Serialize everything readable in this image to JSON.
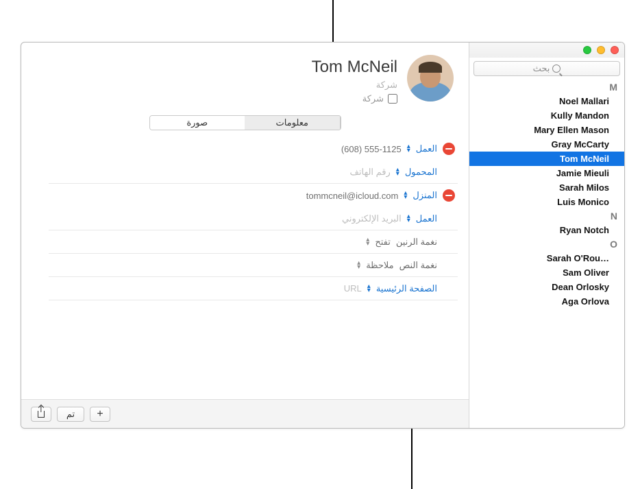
{
  "search": {
    "placeholder": "بحث"
  },
  "sections": [
    {
      "letter": "M",
      "items": [
        "Noel Mallari",
        "Kully Mandon",
        "Mary Ellen Mason",
        "Gray McCarty",
        "Tom McNeil",
        "Jamie Mieuli",
        "Sarah Milos",
        "Luis Monico"
      ]
    },
    {
      "letter": "N",
      "items": [
        "Ryan Notch"
      ]
    },
    {
      "letter": "O",
      "items": [
        "Sarah O'Rou…",
        "Sam Oliver",
        "Dean Orlosky",
        "Aga Orlova"
      ]
    }
  ],
  "selected_index": [
    0,
    4
  ],
  "contact": {
    "name": "Tom  McNeil",
    "company_placeholder": "شركة",
    "company_checkbox_label": "شركة"
  },
  "tabs": {
    "info": "معلومات",
    "photo": "صورة"
  },
  "fields": {
    "phone_work_label": "العمل",
    "phone_work_value": "(608) 555-1125",
    "phone_mobile_label": "المحمول",
    "phone_mobile_placeholder": "رقم الهاتف",
    "email_home_label": "المنزل",
    "email_home_value": "tommcneil@icloud.com",
    "email_work_label": "العمل",
    "email_work_placeholder": "البريد الإلكتروني",
    "ringtone_label": "نغمة الرنين",
    "ringtone_value": "تفتح",
    "texttone_label": "نغمة النص",
    "texttone_value": "ملاحظة",
    "url_label": "الصفحة الرئيسية",
    "url_placeholder": "URL"
  },
  "footer": {
    "done": "تم",
    "add": "+"
  }
}
